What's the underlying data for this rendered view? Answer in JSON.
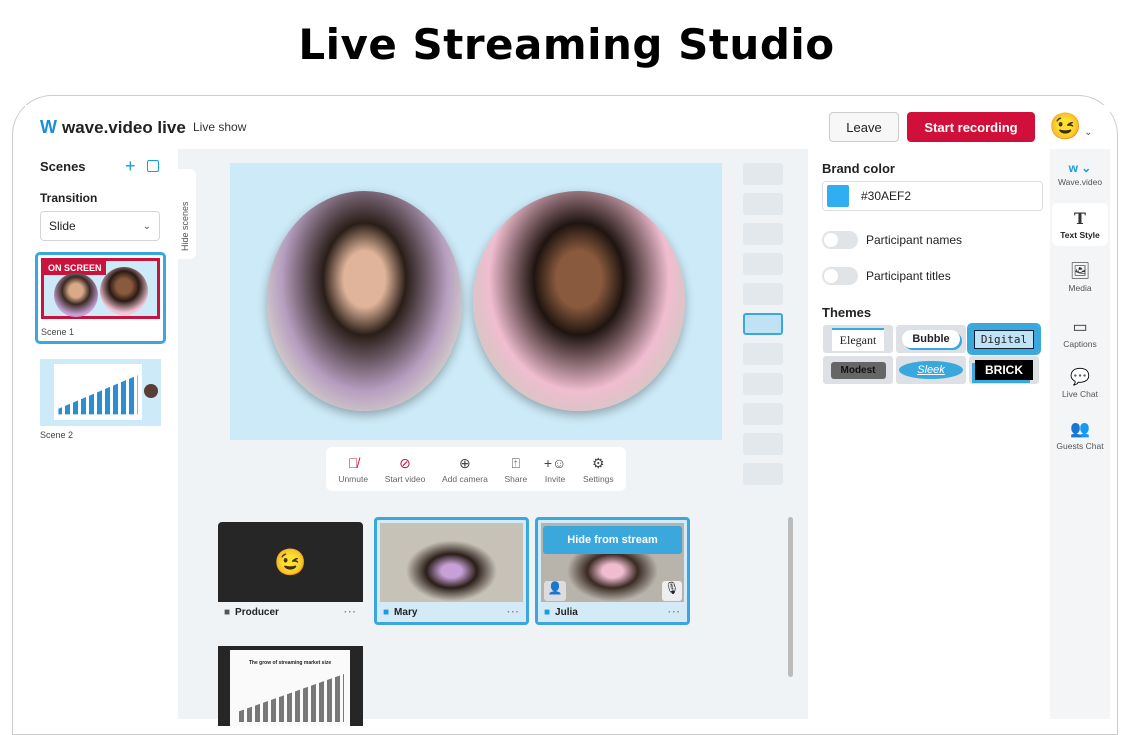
{
  "page_title": "Live Streaming Studio",
  "header": {
    "logo": "wave.video live",
    "show_name": "Live show",
    "leave": "Leave",
    "start_recording": "Start recording",
    "avatar": "😉"
  },
  "sidebar": {
    "scenes_label": "Scenes",
    "transition_label": "Transition",
    "transition_value": "Slide",
    "hide_scenes": "Hide scenes",
    "scenes": [
      {
        "name": "Scene 1",
        "badge": "ON SCREEN"
      },
      {
        "name": "Scene 2"
      }
    ]
  },
  "toolbar": [
    {
      "label": "Unmute",
      "icon": "mic-off"
    },
    {
      "label": "Start video",
      "icon": "camera-off"
    },
    {
      "label": "Add camera",
      "icon": "plus-circle"
    },
    {
      "label": "Share",
      "icon": "share-screen"
    },
    {
      "label": "Invite",
      "icon": "add-user"
    },
    {
      "label": "Settings",
      "icon": "gear"
    }
  ],
  "participants": [
    {
      "name": "Producer",
      "avatar": "😉"
    },
    {
      "name": "Mary"
    },
    {
      "name": "Julia",
      "hover_action": "Hide from stream"
    }
  ],
  "slide_title": "The grow of streaming market size",
  "right_panel": {
    "brand_color_label": "Brand color",
    "brand_color": "#30AEF2",
    "participant_names": "Participant names",
    "participant_titles": "Participant titles",
    "themes_label": "Themes",
    "themes": [
      "Elegant",
      "Bubble",
      "Digital",
      "Modest",
      "Sleek",
      "BRICK"
    ],
    "selected_theme": "Digital"
  },
  "rail": [
    {
      "label": "Wave.video"
    },
    {
      "label": "Text Style",
      "active": true
    },
    {
      "label": "Media"
    },
    {
      "label": "Captions"
    },
    {
      "label": "Live Chat"
    },
    {
      "label": "Guests Chat"
    }
  ],
  "colors": {
    "accent": "#30AEF2",
    "record": "#d0103a",
    "preview_bg": "#cdeaf8"
  }
}
